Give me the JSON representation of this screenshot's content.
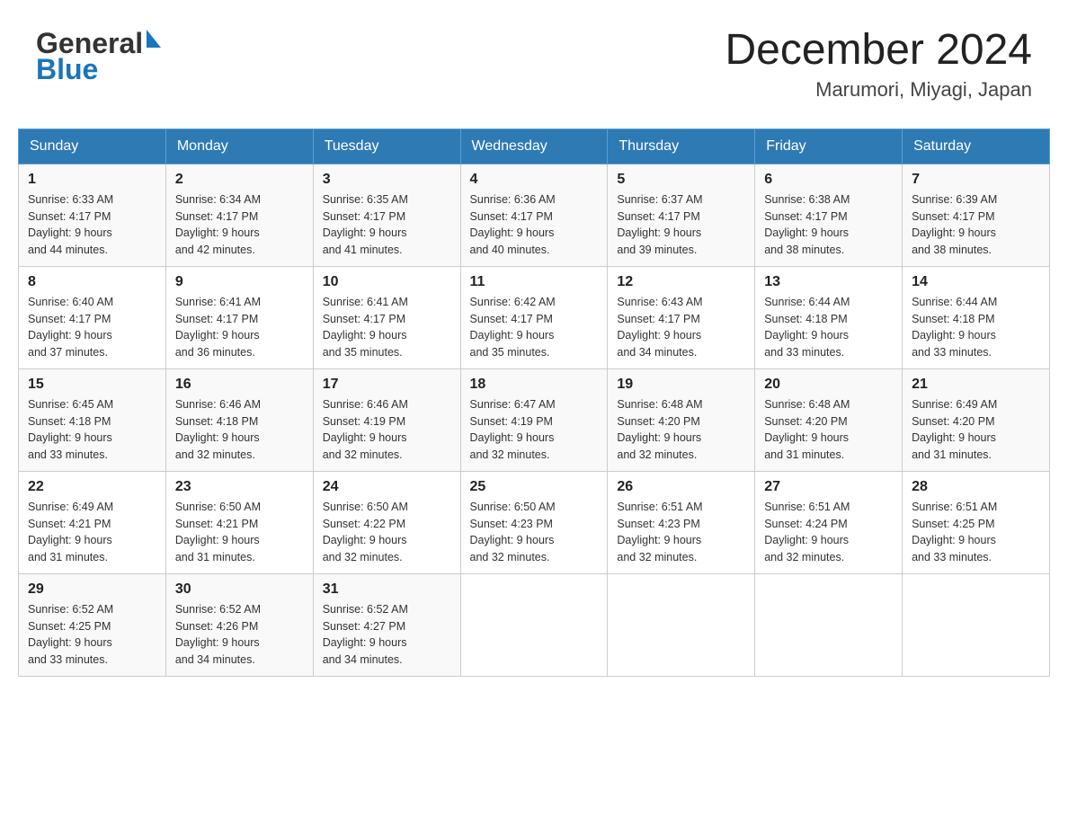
{
  "header": {
    "logo_general": "General",
    "logo_blue": "Blue",
    "month_year": "December 2024",
    "location": "Marumori, Miyagi, Japan"
  },
  "days_of_week": [
    "Sunday",
    "Monday",
    "Tuesday",
    "Wednesday",
    "Thursday",
    "Friday",
    "Saturday"
  ],
  "weeks": [
    [
      {
        "day": "1",
        "sunrise": "6:33 AM",
        "sunset": "4:17 PM",
        "daylight": "9 hours and 44 minutes."
      },
      {
        "day": "2",
        "sunrise": "6:34 AM",
        "sunset": "4:17 PM",
        "daylight": "9 hours and 42 minutes."
      },
      {
        "day": "3",
        "sunrise": "6:35 AM",
        "sunset": "4:17 PM",
        "daylight": "9 hours and 41 minutes."
      },
      {
        "day": "4",
        "sunrise": "6:36 AM",
        "sunset": "4:17 PM",
        "daylight": "9 hours and 40 minutes."
      },
      {
        "day": "5",
        "sunrise": "6:37 AM",
        "sunset": "4:17 PM",
        "daylight": "9 hours and 39 minutes."
      },
      {
        "day": "6",
        "sunrise": "6:38 AM",
        "sunset": "4:17 PM",
        "daylight": "9 hours and 38 minutes."
      },
      {
        "day": "7",
        "sunrise": "6:39 AM",
        "sunset": "4:17 PM",
        "daylight": "9 hours and 38 minutes."
      }
    ],
    [
      {
        "day": "8",
        "sunrise": "6:40 AM",
        "sunset": "4:17 PM",
        "daylight": "9 hours and 37 minutes."
      },
      {
        "day": "9",
        "sunrise": "6:41 AM",
        "sunset": "4:17 PM",
        "daylight": "9 hours and 36 minutes."
      },
      {
        "day": "10",
        "sunrise": "6:41 AM",
        "sunset": "4:17 PM",
        "daylight": "9 hours and 35 minutes."
      },
      {
        "day": "11",
        "sunrise": "6:42 AM",
        "sunset": "4:17 PM",
        "daylight": "9 hours and 35 minutes."
      },
      {
        "day": "12",
        "sunrise": "6:43 AM",
        "sunset": "4:17 PM",
        "daylight": "9 hours and 34 minutes."
      },
      {
        "day": "13",
        "sunrise": "6:44 AM",
        "sunset": "4:18 PM",
        "daylight": "9 hours and 33 minutes."
      },
      {
        "day": "14",
        "sunrise": "6:44 AM",
        "sunset": "4:18 PM",
        "daylight": "9 hours and 33 minutes."
      }
    ],
    [
      {
        "day": "15",
        "sunrise": "6:45 AM",
        "sunset": "4:18 PM",
        "daylight": "9 hours and 33 minutes."
      },
      {
        "day": "16",
        "sunrise": "6:46 AM",
        "sunset": "4:18 PM",
        "daylight": "9 hours and 32 minutes."
      },
      {
        "day": "17",
        "sunrise": "6:46 AM",
        "sunset": "4:19 PM",
        "daylight": "9 hours and 32 minutes."
      },
      {
        "day": "18",
        "sunrise": "6:47 AM",
        "sunset": "4:19 PM",
        "daylight": "9 hours and 32 minutes."
      },
      {
        "day": "19",
        "sunrise": "6:48 AM",
        "sunset": "4:20 PM",
        "daylight": "9 hours and 32 minutes."
      },
      {
        "day": "20",
        "sunrise": "6:48 AM",
        "sunset": "4:20 PM",
        "daylight": "9 hours and 31 minutes."
      },
      {
        "day": "21",
        "sunrise": "6:49 AM",
        "sunset": "4:20 PM",
        "daylight": "9 hours and 31 minutes."
      }
    ],
    [
      {
        "day": "22",
        "sunrise": "6:49 AM",
        "sunset": "4:21 PM",
        "daylight": "9 hours and 31 minutes."
      },
      {
        "day": "23",
        "sunrise": "6:50 AM",
        "sunset": "4:21 PM",
        "daylight": "9 hours and 31 minutes."
      },
      {
        "day": "24",
        "sunrise": "6:50 AM",
        "sunset": "4:22 PM",
        "daylight": "9 hours and 32 minutes."
      },
      {
        "day": "25",
        "sunrise": "6:50 AM",
        "sunset": "4:23 PM",
        "daylight": "9 hours and 32 minutes."
      },
      {
        "day": "26",
        "sunrise": "6:51 AM",
        "sunset": "4:23 PM",
        "daylight": "9 hours and 32 minutes."
      },
      {
        "day": "27",
        "sunrise": "6:51 AM",
        "sunset": "4:24 PM",
        "daylight": "9 hours and 32 minutes."
      },
      {
        "day": "28",
        "sunrise": "6:51 AM",
        "sunset": "4:25 PM",
        "daylight": "9 hours and 33 minutes."
      }
    ],
    [
      {
        "day": "29",
        "sunrise": "6:52 AM",
        "sunset": "4:25 PM",
        "daylight": "9 hours and 33 minutes."
      },
      {
        "day": "30",
        "sunrise": "6:52 AM",
        "sunset": "4:26 PM",
        "daylight": "9 hours and 34 minutes."
      },
      {
        "day": "31",
        "sunrise": "6:52 AM",
        "sunset": "4:27 PM",
        "daylight": "9 hours and 34 minutes."
      },
      null,
      null,
      null,
      null
    ]
  ],
  "labels": {
    "sunrise_prefix": "Sunrise: ",
    "sunset_prefix": "Sunset: ",
    "daylight_prefix": "Daylight: "
  }
}
